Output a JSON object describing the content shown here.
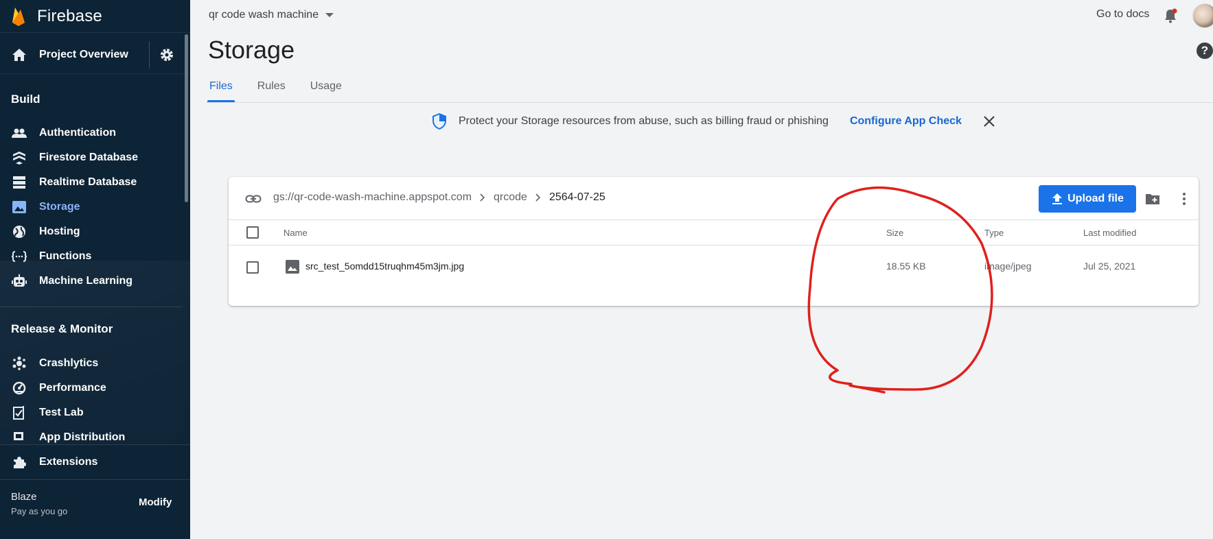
{
  "sidebar": {
    "brand": "Firebase",
    "overview_label": "Project Overview",
    "build_heading": "Build",
    "build_items": [
      {
        "label": "Authentication",
        "icon": "people-icon"
      },
      {
        "label": "Firestore Database",
        "icon": "firestore-icon"
      },
      {
        "label": "Realtime Database",
        "icon": "database-icon"
      },
      {
        "label": "Storage",
        "icon": "image-icon"
      },
      {
        "label": "Hosting",
        "icon": "globe-icon"
      },
      {
        "label": "Functions",
        "icon": "functions-icon"
      },
      {
        "label": "Machine Learning",
        "icon": "robot-icon"
      }
    ],
    "release_heading": "Release & Monitor",
    "release_items": [
      {
        "label": "Crashlytics",
        "icon": "crash-icon"
      },
      {
        "label": "Performance",
        "icon": "speedometer-icon"
      },
      {
        "label": "Test Lab",
        "icon": "checklist-icon"
      },
      {
        "label": "App Distribution",
        "icon": "distribution-icon"
      }
    ],
    "extensions_label": "Extensions",
    "plan_name": "Blaze",
    "plan_desc": "Pay as you go",
    "modify_label": "Modify"
  },
  "topbar": {
    "project_name": "qr code wash machine",
    "docs_label": "Go to docs"
  },
  "page_title": "Storage",
  "tabs": [
    "Files",
    "Rules",
    "Usage"
  ],
  "banner": {
    "message": "Protect your Storage resources from abuse, such as billing fraud or phishing",
    "action": "Configure App Check"
  },
  "browser": {
    "breadcrumbs": [
      "gs://qr-code-wash-machine.appspot.com",
      "qrcode",
      "2564-07-25"
    ],
    "upload_label": "Upload file",
    "columns": {
      "name": "Name",
      "size": "Size",
      "type": "Type",
      "modified": "Last modified"
    },
    "rows": [
      {
        "name": "src_test_5omdd15truqhm45m3jm.jpg",
        "size": "18.55 KB",
        "type": "image/jpeg",
        "modified": "Jul 25, 2021"
      }
    ]
  },
  "colors": {
    "sidebar_bg": "#0d2336",
    "accent": "#1a73e8",
    "active_nav": "#8ab4f8",
    "annotation_red": "#e0201c"
  }
}
